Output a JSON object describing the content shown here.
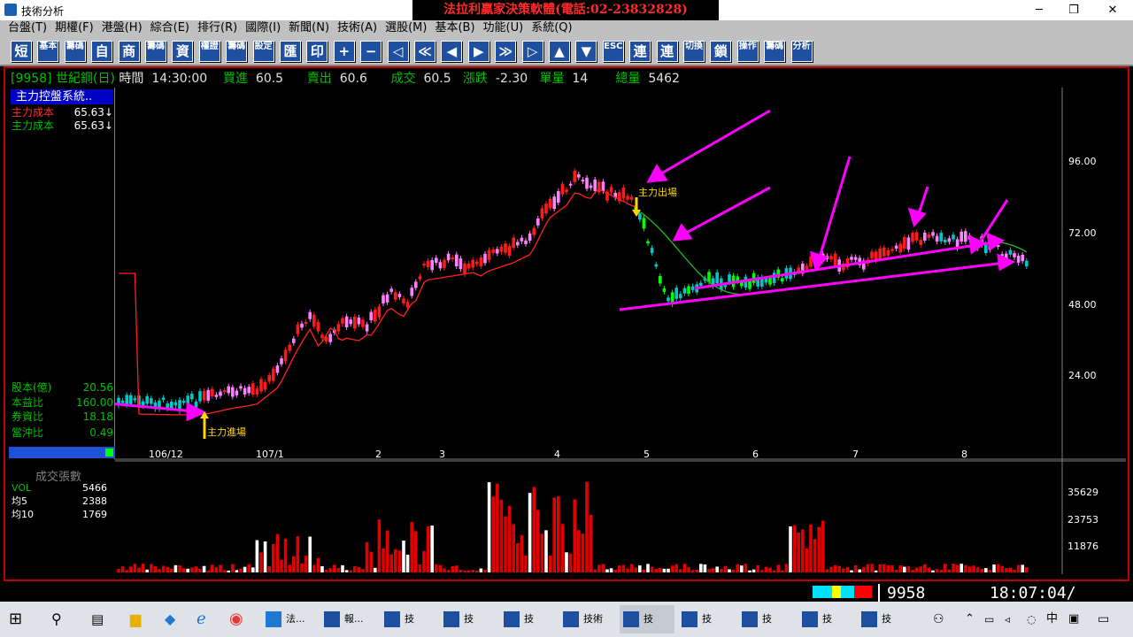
{
  "window": {
    "title": "技術分析",
    "banner": "法拉利贏家決策軟體(電話:02-23832828)",
    "controls": [
      "─",
      "❐",
      "✕"
    ]
  },
  "menu": [
    "台盤(T)",
    "期權(F)",
    "港盤(H)",
    "綜合(E)",
    "排行(R)",
    "國際(I)",
    "新聞(N)",
    "技術(A)",
    "選股(M)",
    "基本(B)",
    "功能(U)",
    "系統(Q)"
  ],
  "toolbar": [
    "短",
    "基本",
    "籌碼",
    "自",
    "商",
    "籌碼",
    "資",
    "權證",
    "籌碼",
    "設定",
    "匯",
    "印",
    "+",
    "−",
    "◁",
    "≪",
    "◀",
    "▶",
    "≫",
    "▷",
    "▲",
    "▼",
    "ESC",
    "連",
    "連",
    "切換",
    "鎖",
    "操作",
    "籌碼",
    "分析"
  ],
  "quote": {
    "code": "[9958]",
    "name": "世紀鋼(日)",
    "time_label": "時間",
    "time": "14:30:00",
    "bid_label": "買進",
    "bid": "60.5",
    "ask_label": "賣出",
    "ask": "60.6",
    "deal_label": "成交",
    "deal": "60.5",
    "change_label": "漲跌",
    "change": "-2.30",
    "single_label": "單量",
    "single": "14",
    "total_label": "總量",
    "total": "5462"
  },
  "panel": {
    "title": "主力控盤系統..",
    "rows": [
      {
        "label": "主力成本",
        "value": "65.63↓",
        "color": "#ff3030"
      },
      {
        "label": "主力成本",
        "value": "65.63↓",
        "color": "#00c000"
      }
    ],
    "stats": [
      {
        "label": "股本(億)",
        "value": "20.56"
      },
      {
        "label": "本益比",
        "value": "160.00"
      },
      {
        "label": "券資比",
        "value": "18.18"
      },
      {
        "label": "當沖比",
        "value": "0.49"
      }
    ]
  },
  "chart_data": {
    "type": "candlestick",
    "price_axis": [
      "96.00",
      "72.00",
      "48.00",
      "24.00"
    ],
    "x_labels": [
      "106/12",
      "107/1",
      "2",
      "3",
      "4",
      "5",
      "6",
      "7",
      "8"
    ],
    "annotations": [
      "主力進場",
      "主力出場"
    ],
    "volume": {
      "title": "成交張數",
      "rows": [
        {
          "label": "VOL",
          "value": "5466"
        },
        {
          "label": "均5",
          "value": "2388"
        },
        {
          "label": "均10",
          "value": "1769"
        }
      ],
      "axis": [
        "35629",
        "23753",
        "11876"
      ]
    }
  },
  "status": {
    "code": "9958",
    "time": "18:07:04/"
  },
  "taskbar": {
    "items": [
      "法...",
      "報...",
      "技",
      "技",
      "技",
      "技術",
      "技",
      "技",
      "技",
      "技",
      "技"
    ],
    "tray": "中"
  },
  "colors": {
    "up": "#ff1a1a",
    "down": "#00c8c8",
    "neutral": "#ffffff",
    "cost_line": "#ff2020",
    "forecast_line": "#20c020",
    "arrow": "#ff00ff",
    "volume_up": "#ff0000"
  }
}
